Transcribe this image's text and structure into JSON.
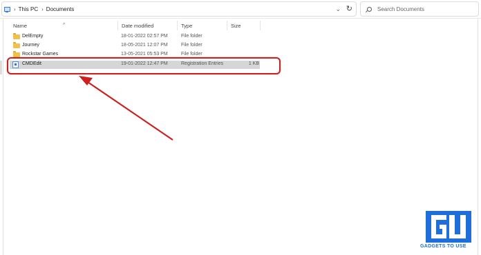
{
  "address": {
    "crumbs": [
      "This PC",
      "Documents"
    ],
    "separator": "›"
  },
  "search": {
    "placeholder": "Search Documents"
  },
  "columns": {
    "name": "Name",
    "date_modified": "Date modified",
    "type": "Type",
    "size": "Size"
  },
  "files": [
    {
      "name": "DelEmpty",
      "date": "18-01-2022 02:57 PM",
      "type": "File folder",
      "size": "",
      "icon": "folder-icon"
    },
    {
      "name": "Journey",
      "date": "18-05-2021 12:07 PM",
      "type": "File folder",
      "size": "",
      "icon": "folder-icon"
    },
    {
      "name": "Rockstar Games",
      "date": "13-05-2021 05:53 PM",
      "type": "File folder",
      "size": "",
      "icon": "folder-icon"
    },
    {
      "name": "CMDEdit",
      "date": "19-01-2022 12:47 PM",
      "type": "Registration Entries",
      "size": "1 KB",
      "icon": "registry-file-icon",
      "selected": true
    }
  ],
  "annotation": {
    "color": "#cc1f1f"
  },
  "watermark": {
    "text": "GADGETS TO USE",
    "color": "#1e6fd9"
  }
}
